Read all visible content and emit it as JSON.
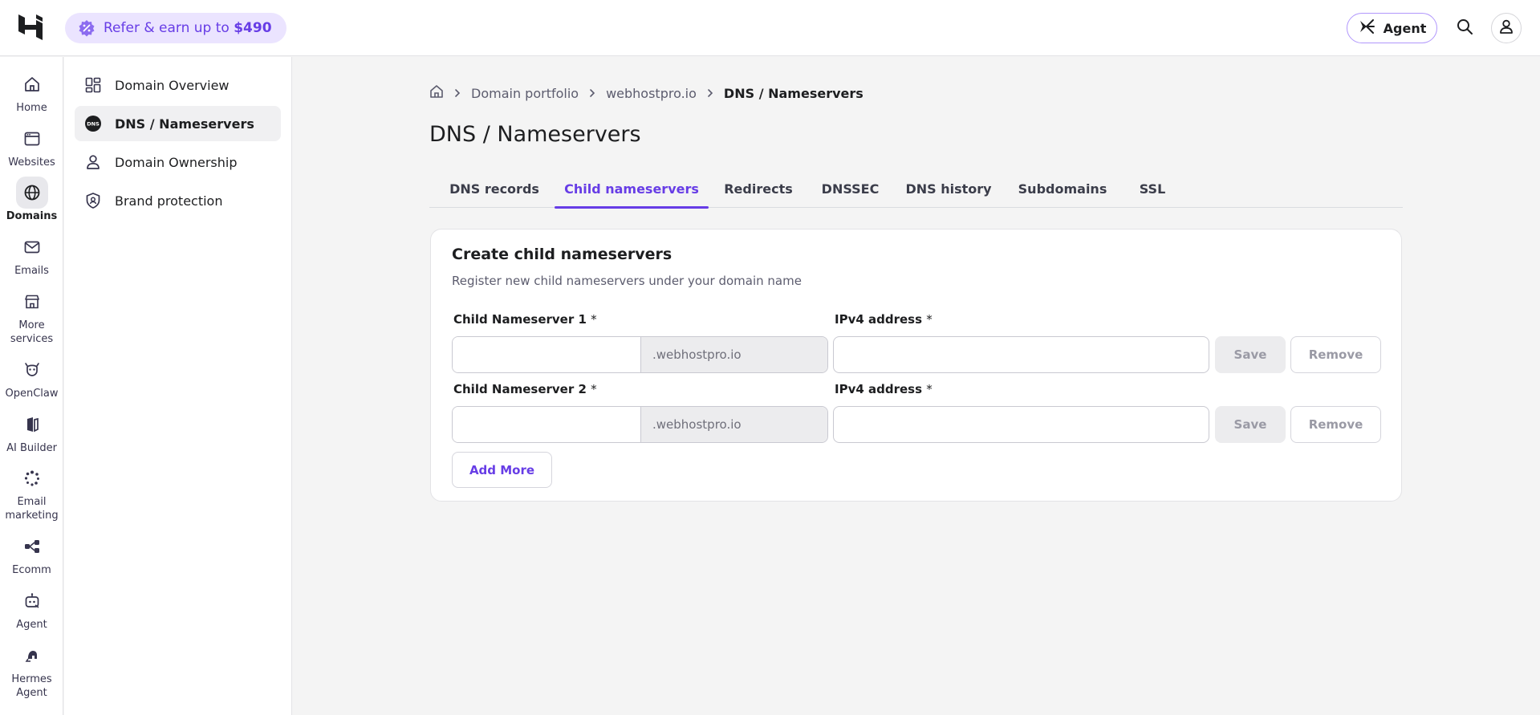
{
  "topbar": {
    "refer_text": "Refer & earn up to",
    "refer_amount": "$490",
    "agent_label": "Agent"
  },
  "rail": {
    "items": [
      {
        "label": "Home",
        "icon": "home-icon"
      },
      {
        "label": "Websites",
        "icon": "browser-window-icon"
      },
      {
        "label": "Domains",
        "icon": "globe-icon",
        "active": true
      },
      {
        "label": "Emails",
        "icon": "mail-icon"
      },
      {
        "label": "More services",
        "icon": "store-icon"
      },
      {
        "label": "OpenClaw",
        "icon": "openclaw-icon"
      },
      {
        "label": "AI Builder",
        "icon": "ai-builder-icon"
      },
      {
        "label": "Email marketing",
        "icon": "sparkle-burst-icon"
      },
      {
        "label": "Ecomm",
        "icon": "share-nodes-icon"
      },
      {
        "label": "Agent",
        "icon": "robot-icon"
      },
      {
        "label": "Hermes Agent",
        "icon": "hermes-icon"
      }
    ]
  },
  "subnav": {
    "items": [
      {
        "label": "Domain Overview",
        "icon": "dashboard-grid-icon"
      },
      {
        "label": "DNS / Nameservers",
        "icon": "dns-badge-icon",
        "active": true
      },
      {
        "label": "Domain Ownership",
        "icon": "person-icon"
      },
      {
        "label": "Brand protection",
        "icon": "shield-icon"
      }
    ]
  },
  "breadcrumb": {
    "items": [
      "Domain portfolio",
      "webhostpro.io"
    ],
    "current": "DNS / Nameservers"
  },
  "page": {
    "title": "DNS / Nameservers"
  },
  "tabs": [
    {
      "label": "DNS records"
    },
    {
      "label": "Child nameservers",
      "active": true
    },
    {
      "label": "Redirects"
    },
    {
      "label": "DNSSEC"
    },
    {
      "label": "DNS history"
    },
    {
      "label": "Subdomains"
    },
    {
      "label": "SSL"
    }
  ],
  "card": {
    "title": "Create child nameservers",
    "subtitle": "Register new child nameservers under your domain name",
    "rows": [
      {
        "ns_label": "Child Nameserver 1",
        "ns_value": "",
        "suffix": ".webhostpro.io",
        "ip_label": "IPv4 address",
        "ip_value": "",
        "save_label": "Save",
        "remove_label": "Remove"
      },
      {
        "ns_label": "Child Nameserver 2",
        "ns_value": "",
        "suffix": ".webhostpro.io",
        "ip_label": "IPv4 address",
        "ip_value": "",
        "save_label": "Save",
        "remove_label": "Remove"
      }
    ],
    "required_mark": "*",
    "add_more_label": "Add More"
  },
  "colors": {
    "accent": "#673de6",
    "accent_soft": "#ebe4ff",
    "page_bg": "#f4f4f4"
  }
}
